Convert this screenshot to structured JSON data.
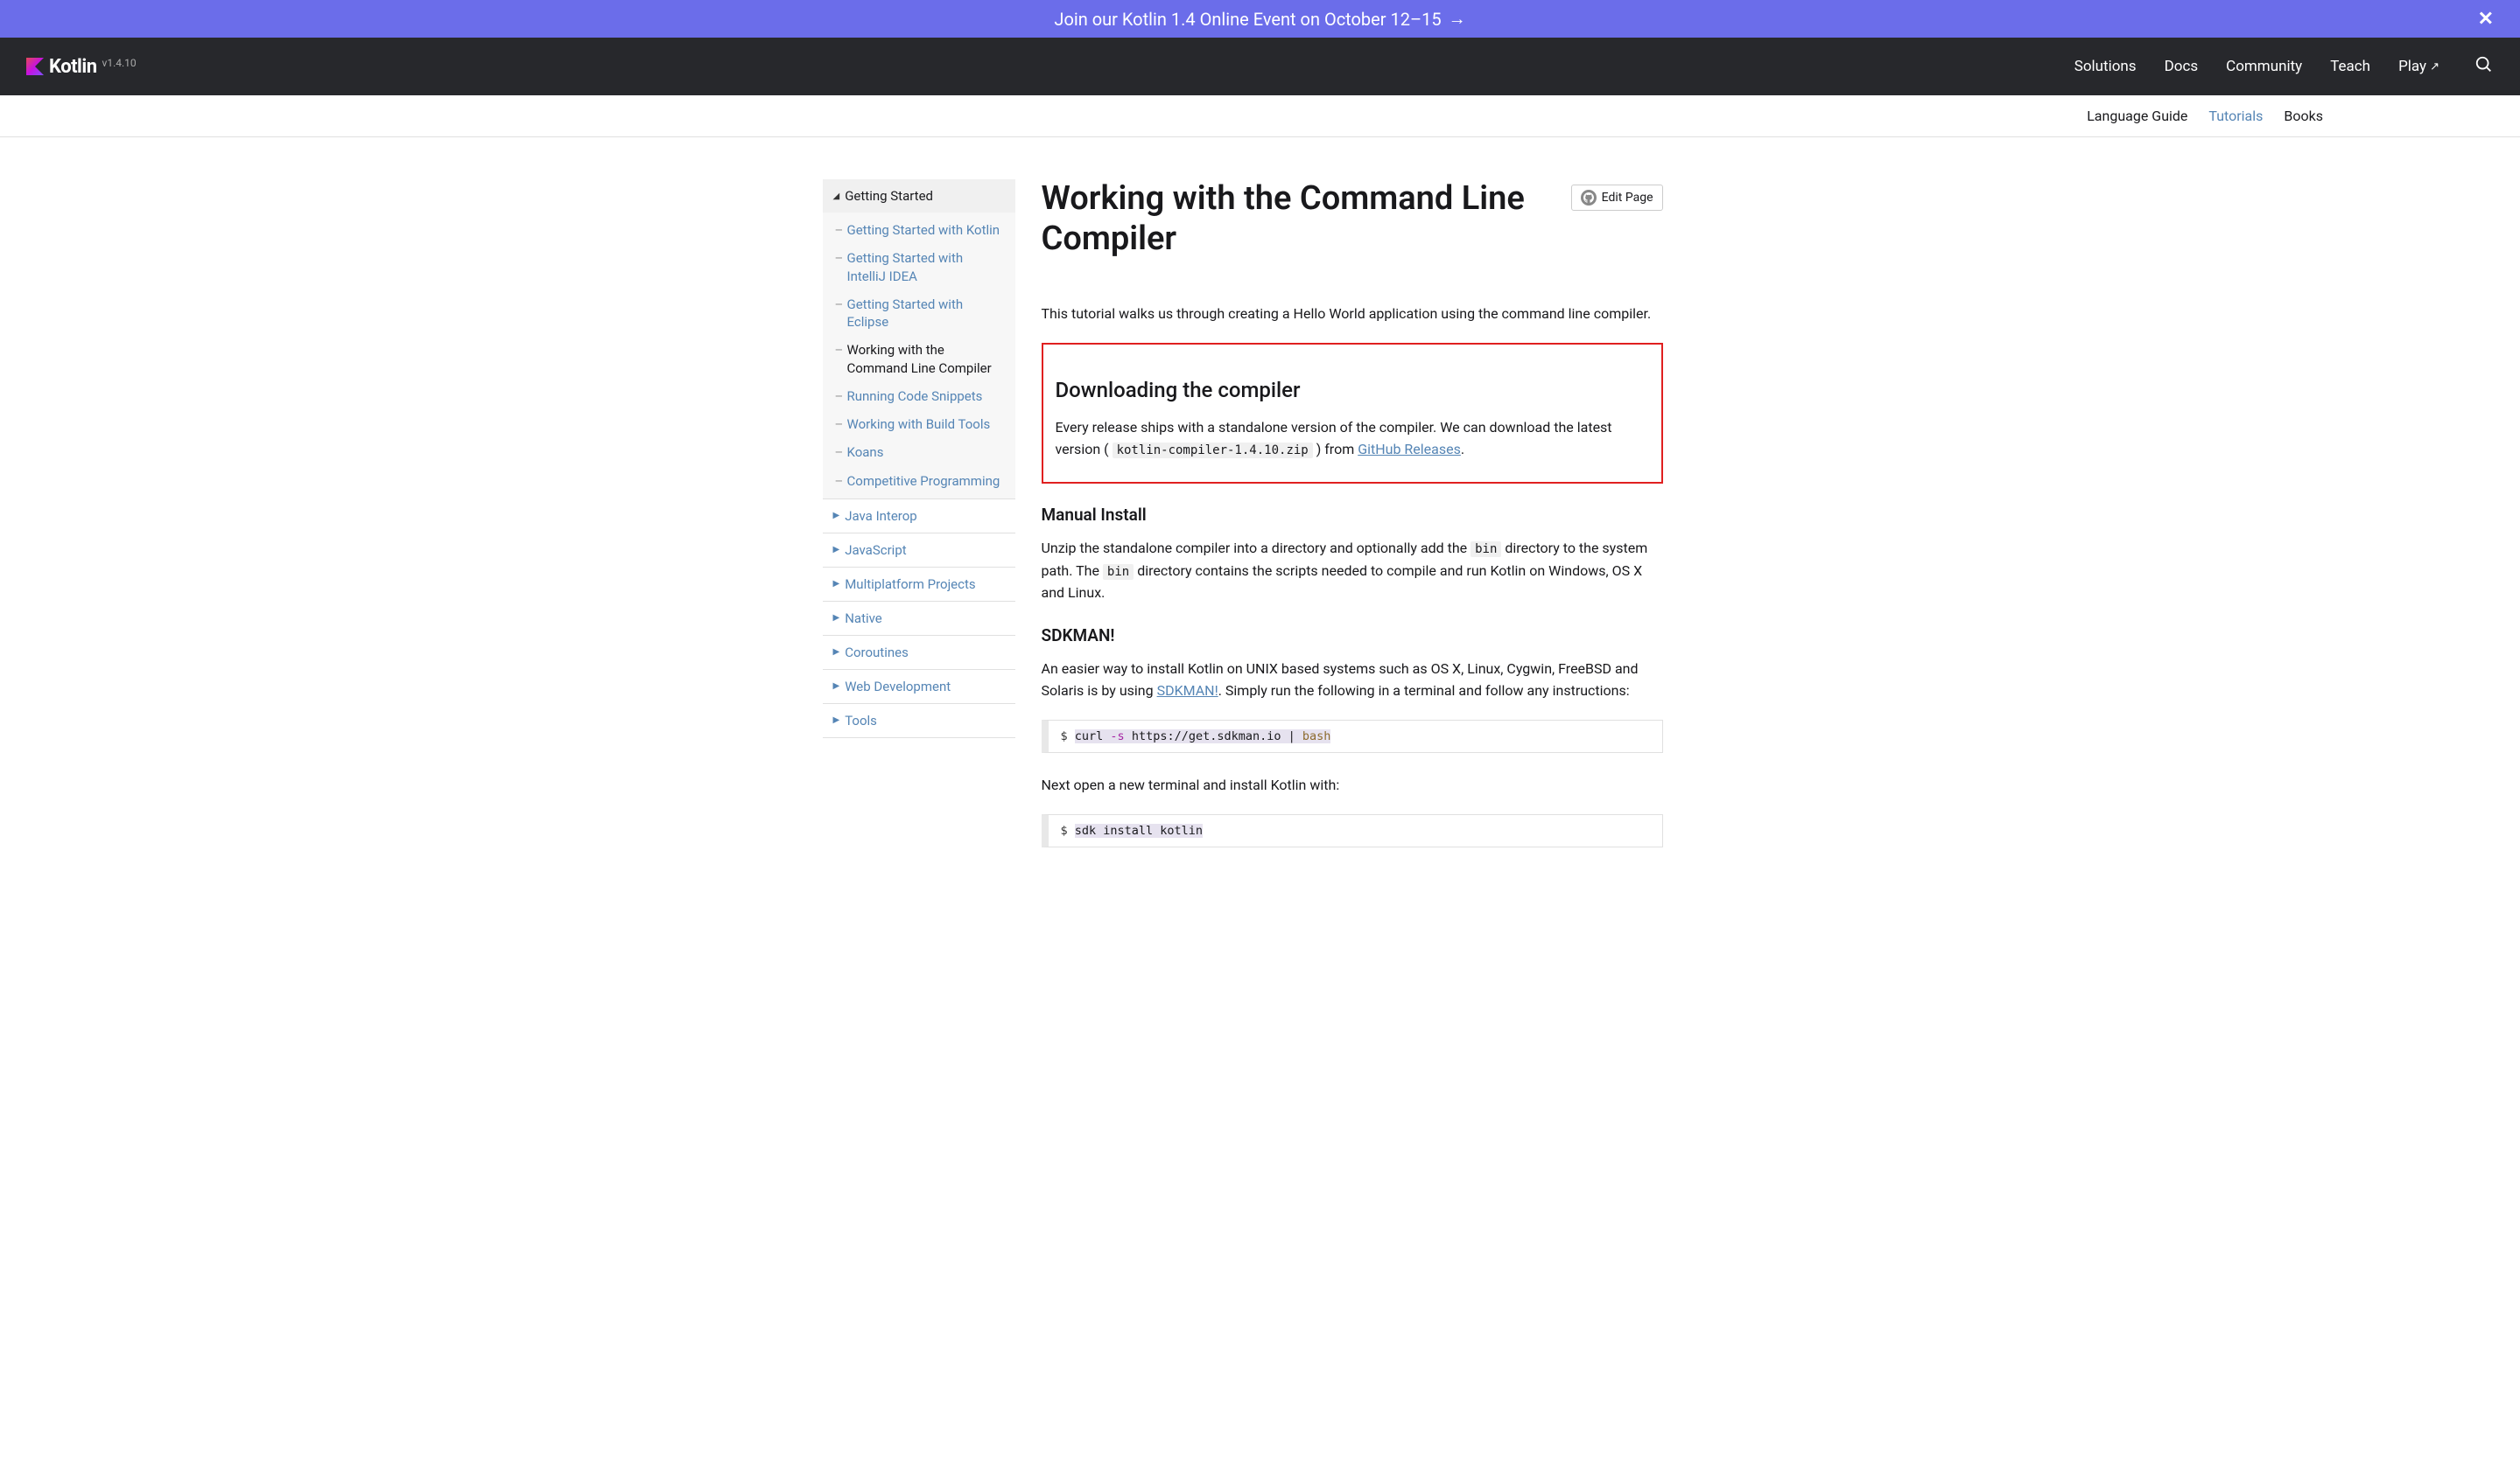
{
  "banner": {
    "text": "Join our Kotlin 1.4 Online Event on October 12–15",
    "arrow": "→",
    "close": "✕"
  },
  "topnav": {
    "logo": "Kotlin",
    "version": "v1.4.10",
    "items": [
      "Solutions",
      "Docs",
      "Community",
      "Teach",
      "Play"
    ],
    "play_ext": "↗"
  },
  "subnav": {
    "items": [
      "Language Guide",
      "Tutorials",
      "Books"
    ],
    "active_index": 1
  },
  "sidebar": {
    "expanded": {
      "title": "Getting Started",
      "items": [
        "Getting Started with Kotlin",
        "Getting Started with IntelliJ IDEA",
        "Getting Started with Eclipse",
        "Working with the Command Line Compiler",
        "Running Code Snippets",
        "Working with Build Tools",
        "Koans",
        "Competitive Programming"
      ],
      "active_index": 3
    },
    "collapsed": [
      "Java Interop",
      "JavaScript",
      "Multiplatform Projects",
      "Native",
      "Coroutines",
      "Web Development",
      "Tools"
    ]
  },
  "main": {
    "title": "Working with the Command Line Compiler",
    "edit_label": "Edit Page",
    "intro": "This tutorial walks us through creating a Hello World application using the command line compiler.",
    "h2_download": "Downloading the compiler",
    "download_p_pre": "Every release ships with a standalone version of the compiler. We can download the latest version ( ",
    "download_code": "kotlin-compiler-1.4.10.zip",
    "download_p_mid": " ) from ",
    "download_link": "GitHub Releases",
    "download_p_end": ".",
    "h3_manual": "Manual Install",
    "manual_p1_a": "Unzip the standalone compiler into a directory and optionally add the ",
    "manual_code1": "bin",
    "manual_p1_b": " directory to the system path. The ",
    "manual_code2": "bin",
    "manual_p1_c": " directory contains the scripts needed to compile and run Kotlin on Windows, OS X and Linux.",
    "h3_sdkman": "SDKMAN!",
    "sdkman_p_a": "An easier way to install Kotlin on UNIX based systems such as OS X, Linux, Cygwin, FreeBSD and Solaris is by using ",
    "sdkman_link": "SDKMAN!",
    "sdkman_p_b": ". Simply run the following in a terminal and follow any instructions:",
    "code1_prompt": "$ ",
    "code1_cmd": "curl",
    "code1_flag": "-s",
    "code1_rest": "https://get.sdkman.io |",
    "code1_bash": "bash",
    "next_p": "Next open a new terminal and install Kotlin with:",
    "code2_prompt": "$ ",
    "code2_cmd": "sdk install kotlin"
  }
}
